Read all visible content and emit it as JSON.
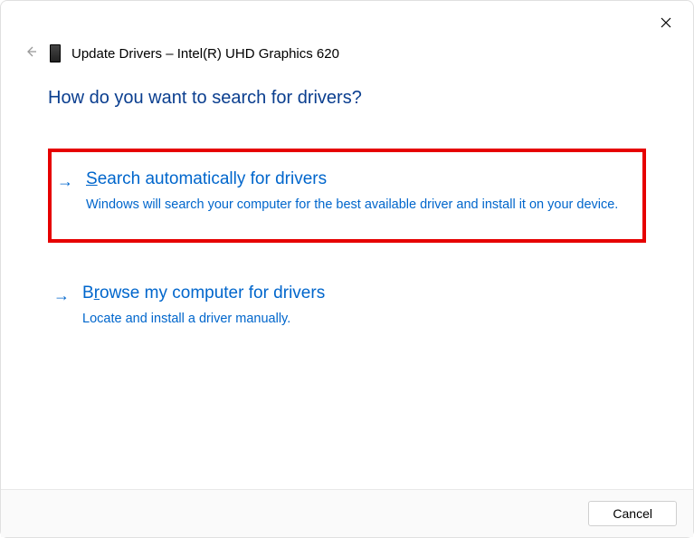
{
  "header": {
    "title": "Update Drivers – Intel(R) UHD Graphics 620"
  },
  "question": "How do you want to search for drivers?",
  "options": [
    {
      "title_prefix": "S",
      "title_rest": "earch automatically for drivers",
      "description": "Windows will search your computer for the best available driver and install it on your device."
    },
    {
      "title_prefix": "B",
      "title_mid": "r",
      "title_rest": "owse my computer for drivers",
      "description": "Locate and install a driver manually."
    }
  ],
  "footer": {
    "cancel_label": "Cancel"
  }
}
